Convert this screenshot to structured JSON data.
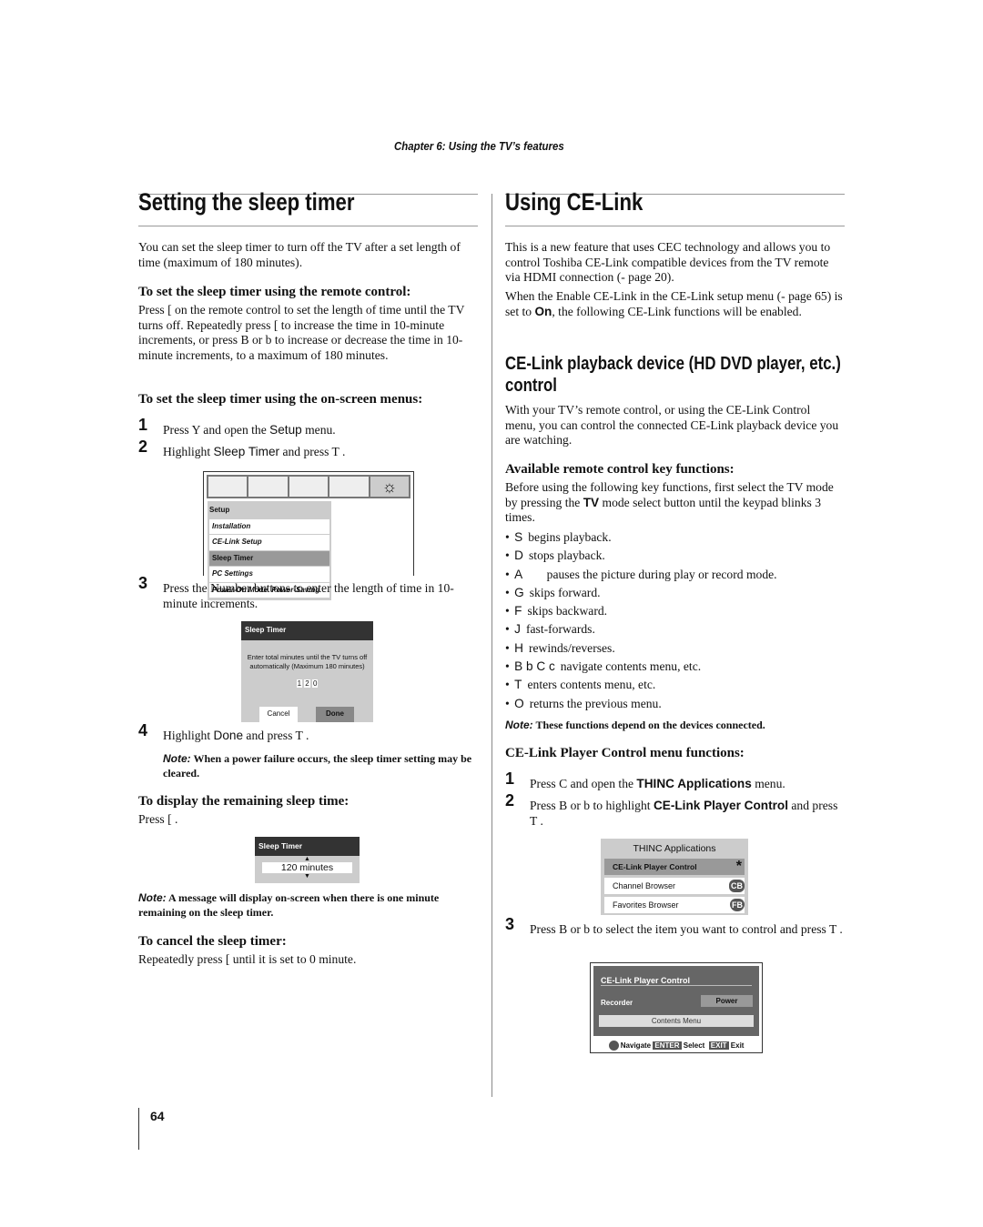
{
  "header": {
    "chapter": "Chapter 6: Using the TV’s features"
  },
  "left": {
    "title": "Setting the sleep timer",
    "intro": "You can set the sleep timer to turn off the TV after a set length of time (maximum of 180 minutes).",
    "remote_heading": "To set the sleep timer using the remote control:",
    "remote_text": "Press [      on the remote control to set the length of time until the TV turns off. Repeatedly press [      to increase the time in 10-minute increments, or press B or b  to increase or decrease the time in 10-minute increments, to a maximum of 180 minutes.",
    "menu_heading": "To set the sleep timer using the on-screen menus:",
    "steps": [
      {
        "n": "1",
        "pre": "Press Y      and open the ",
        "bold": "Setup",
        "post": " menu."
      },
      {
        "n": "2",
        "pre": "Highlight ",
        "bold": "Sleep Timer",
        "post": " and press T  ."
      },
      {
        "n": "3",
        "pre": "Press the Number buttons to enter the length of time in 10-minute increments.",
        "bold": "",
        "post": ""
      },
      {
        "n": "4",
        "pre": "Highlight ",
        "bold": "Done",
        "post": " and press T  ."
      }
    ],
    "setup_menu": {
      "title": "Setup",
      "items": [
        "Installation",
        "CE-Link Setup",
        "Sleep Timer",
        "PC Settings",
        "Power-On Mode",
        "Power-Saving"
      ],
      "selected": "Sleep Timer"
    },
    "sleep_dialog": {
      "title": "Sleep Timer",
      "message": "Enter total minutes until the TV turns off automatically (Maximum 180 minutes)",
      "digits": [
        "1",
        "2",
        "0"
      ],
      "cancel": "Cancel",
      "done": "Done"
    },
    "note1_label": "Note:",
    "note1": " When a power failure occurs, the sleep timer setting may be cleared.",
    "remaining_heading": "To display the remaining sleep time:",
    "remaining_text": "Press [      .",
    "remaining_box": {
      "title": "Sleep Timer",
      "value": "120 minutes"
    },
    "note2_label": "Note:",
    "note2": " A message will display on-screen when there is one minute remaining on the sleep timer.",
    "cancel_heading": "To cancel the sleep timer:",
    "cancel_text": "Repeatedly press [      until it is set to 0 minute."
  },
  "right": {
    "title": "Using CE-Link",
    "intro": "This is a new feature that uses CEC technology and allows you to control Toshiba CE-Link compatible devices from the TV remote via HDMI connection (-    page 20).",
    "intro2_pre": "When the Enable CE-Link in the CE-Link setup menu (-  page 65) is set to ",
    "intro2_bold": "On",
    "intro2_post": ", the following CE-Link functions will be enabled.",
    "subtitle": "CE-Link playback device (HD DVD player, etc.) control",
    "sub_text": "With your TV’s remote control, or using the CE-Link Control menu, you can control the connected CE-Link playback device you are watching.",
    "keys_heading": "Available remote control key functions:",
    "keys_intro_pre": "Before using the following key functions, first select the TV mode by pressing the ",
    "keys_intro_bold": "TV",
    "keys_intro_post": " mode select button until the keypad blinks 3 times.",
    "keys": [
      {
        "key": "S",
        "text": "begins playback."
      },
      {
        "key": "D",
        "text": "stops playback."
      },
      {
        "key": "A",
        "text": "      pauses the picture during play or record mode."
      },
      {
        "key": "G",
        "text": "skips forward."
      },
      {
        "key": "F",
        "text": "skips backward."
      },
      {
        "key": "J",
        "text": "fast-forwards."
      },
      {
        "key": "H",
        "text": "rewinds/reverses."
      },
      {
        "key": "B b C c",
        "text": "navigate contents menu, etc."
      },
      {
        "key": "T",
        "text": "enters contents menu, etc."
      },
      {
        "key": "O",
        "text": "returns the previous menu."
      }
    ],
    "note_label": "Note:",
    "note": " These functions depend on the devices connected.",
    "player_heading": "CE-Link Player Control menu functions:",
    "steps": [
      {
        "n": "1",
        "pre": "Press C      and open the ",
        "bold": "THINC Applications",
        "post": " menu."
      },
      {
        "n": "2",
        "pre": "Press B or b  to highlight ",
        "bold": "CE-Link Player Control",
        "post": " and press T  ."
      },
      {
        "n": "3",
        "pre": "Press B or b  to select the item you want to control and press T  .",
        "bold": "",
        "post": ""
      }
    ],
    "thinc": {
      "title": "THINC Applications",
      "items": [
        {
          "label": "CE-Link Player Control",
          "icon": "*"
        },
        {
          "label": "Channel Browser",
          "icon": "CB"
        },
        {
          "label": "Favorites Browser",
          "icon": "FB"
        }
      ]
    },
    "player": {
      "title": "CE-Link Player Control",
      "recorder": "Recorder",
      "power": "Power",
      "contents": "Contents Menu",
      "navigate": "Navigate",
      "enter": "ENTER",
      "select": "Select",
      "exit_key": "EXIT",
      "exit": "Exit"
    }
  },
  "footer": {
    "page_number": "64"
  }
}
